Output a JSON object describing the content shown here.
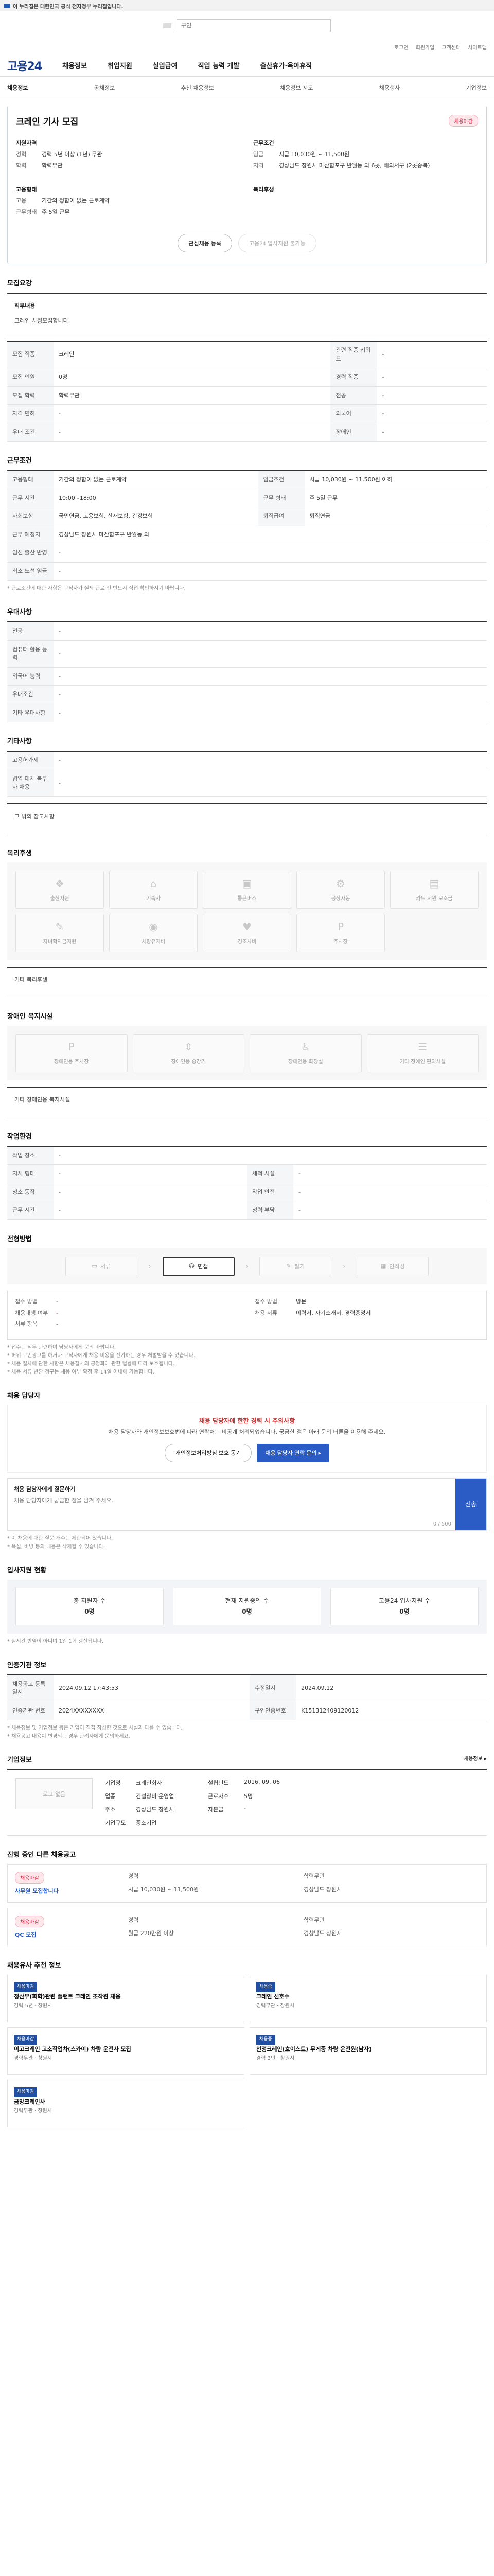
{
  "gov_banner": "이 누리집은 대한민국 공식 전자정부 누리집입니다.",
  "search_placeholder": "구인",
  "util": [
    "로그인",
    "회원가입",
    "고객센터",
    "사이트맵"
  ],
  "logo": "고용24",
  "gnb": [
    "채용정보",
    "취업지원",
    "실업급여",
    "직업 능력 개발",
    "출산휴가·육아휴직"
  ],
  "subnav": [
    "채용정보",
    "공채정보",
    "추천 채용정보",
    "채용정보 지도",
    "채용행사",
    "기업정보"
  ],
  "job": {
    "title": "크레인 기사 모집",
    "badge": "채용마감"
  },
  "summary": {
    "left_head": "지원자격",
    "left_rows": [
      [
        "경력",
        "경력 5년 이상 (1년) 무관"
      ],
      [
        "학력",
        "학력무관"
      ]
    ],
    "right_head": "근무조건",
    "right_rows": [
      [
        "임금",
        "시급 10,030원 ~ 11,500원"
      ],
      [
        "지역",
        "경상남도 창원시 마산합포구 반월동 외 6곳, 해의서구 (2곳중복)"
      ]
    ],
    "l2_head": "고용형태",
    "l2_rows": [
      [
        "고용",
        "기간의 정함이 없는 근로계약"
      ],
      [
        "근무형태",
        "주 5일 근무"
      ]
    ],
    "r2_head": "복리후생"
  },
  "buttons": {
    "save": "관심채용 등록",
    "apply": "고용24 입사지원 불가능"
  },
  "recruit": {
    "heading": "모집요강",
    "job_label": "직무내용",
    "job_text": "크레인 사정모집합니다."
  },
  "recruit_table": [
    [
      "모집 직종",
      "크레인",
      "관련 직종 키워드",
      "-"
    ],
    [
      "모집 인원",
      "0명",
      "경력 직종",
      "-"
    ],
    [
      "모집 학력",
      "학력무관",
      "전공",
      "-"
    ],
    [
      "자격 면허",
      "-",
      "외국어",
      "-"
    ],
    [
      "우대 조건",
      "-",
      "장애인",
      "-"
    ]
  ],
  "work_heading": "근무조건",
  "work_table": [
    [
      "고용형태",
      "기간의 정함이 없는 근로계약",
      "임금조건",
      "시급 10,030원 ~ 11,500원 이하"
    ],
    [
      "근무 시간",
      "10:00~18:00",
      "근무 형태",
      "주 5일 근무"
    ],
    [
      "사회보험",
      "국민연금, 고용보험, 산재보험, 건강보험",
      "퇴직급여",
      "퇴직연금"
    ],
    [
      "근무 예정지",
      "경상남도 창원시 마산합포구 반월동 외",
      "",
      ""
    ]
  ],
  "work_extra": [
    "임신 출산 반영",
    "최소 노선 임금"
  ],
  "work_note": "* 근로조건에 대한 사항은 구직자가 실제 근로 전 반드시 직접 확인하시기 바랍니다.",
  "prep_heading": "우대사항",
  "prep_rows": [
    "전공",
    "컴퓨터 활용 능력",
    "외국어 능력",
    "우대조건",
    "기타 우대사항"
  ],
  "etc_heading": "기타사항",
  "etc_rows": [
    [
      "고용허가제",
      "-"
    ],
    [
      "병역 대체 복무자 채용",
      "-"
    ]
  ],
  "etc_text": "그 밖의 참고사항",
  "welfare_heading": "복리후생",
  "welfare": [
    "출산지원",
    "기숙사",
    "통근버스",
    "공장자동",
    "카드 지원 보조금",
    "자녀학자금지원",
    "차량유지비",
    "경조사비",
    "주차장"
  ],
  "welfare_other": "기타 복리후생",
  "disabled_heading": "장애인 복지시설",
  "disabled": [
    "장애인용 주차장",
    "장애인용 승강기",
    "장애인용 화장실",
    "기타 장애인 편의시설"
  ],
  "disabled_other": "기타 장애인용 복지시설",
  "work_env_heading": "작업환경",
  "work_env": [
    [
      "작업 장소",
      "-",
      "",
      ""
    ],
    [
      "지시 형태",
      "-",
      "세척 시설",
      "-"
    ],
    [
      "청소 동작",
      "-",
      "작업 안전",
      "-"
    ],
    [
      "근무 시간",
      "-",
      "청력 부담",
      "-"
    ]
  ],
  "process_heading": "전형방법",
  "process": [
    "서류",
    "면접",
    "필기",
    "인적성"
  ],
  "doc_left": [
    "접수 방법",
    "채용대행 여부",
    "서류 항목"
  ],
  "doc_right": [
    "접수 방법",
    "방문",
    "채용 서류",
    "이력서, 자기소개서, 경력증명서"
  ],
  "proc_notes": [
    "* 접수는 직무 관련하여 담당자에게 문의 바랍니다.",
    "* 허위 구인광고를 하거나 구직자에게 채용 비용을 전가하는 경우 처벌받을 수 있습니다.",
    "* 채용 절차에 관한 사항은 채용절차의 공정화에 관한 법률에 따라 보호됩니다.",
    "* 채용 서류 반환 청구는 채용 여부 확정 후 14일 이내에 가능합니다."
  ],
  "contact": {
    "heading": "채용 담당자",
    "title": "채용 담당자에 한한 경력 시 주의사항",
    "body": "채용 담당자와 개인정보보호법에 따라 연락처는 비공개 처리되었습니다. 궁금한 점은 아래 문의 버튼을 이용해 주세요.",
    "b1": "개인정보처리방침 보호 동기",
    "b2": "채용 담당자 연락 문의 ▸"
  },
  "qa": {
    "label": "채용 담당자에게 질문하기",
    "count": "0 / 500",
    "placeholder": "채용 담당자에게 궁금한 점을 남겨 주세요.",
    "send": "전송"
  },
  "qa_notes": [
    "* 이 채용에 대한 질문 개수는 제한되어 있습니다.",
    "* 욕설, 비방 등의 내용은 삭제될 수 있습니다."
  ],
  "status_heading": "입사지원 현황",
  "status": [
    [
      "총 지원자 수",
      "0명"
    ],
    [
      "현재 지원중인 수",
      "0명"
    ],
    [
      "고용24 입사지원 수",
      "0명"
    ]
  ],
  "status_note": "* 실시간 반영이 아니며 1일 1회 갱신됩니다.",
  "info_heading": "인증기관 정보",
  "info_table": [
    [
      "채용공고 등록일시",
      "2024.09.12 17:43:53",
      "수정일시",
      "2024.09.12"
    ],
    [
      "인증기관 번호",
      "2024XXXXXXXX",
      "구인인증번호",
      "K151312409120012"
    ]
  ],
  "info_notes": [
    "* 채용정보 및 기업정보 등은 기업이 직접 작성한 것으로 사실과 다를 수 있습니다.",
    "* 채용공고 내용이 변경되는 경우 관리자에게 문의하세요."
  ],
  "company_heading": "기업정보",
  "company_more": "채용정보 ▸",
  "company": {
    "logo": "로고 없음",
    "rows": [
      [
        "기업명",
        "크레인회사",
        "설립년도",
        "2016. 09. 06"
      ],
      [
        "업종",
        "건설장비 운영업",
        "근로자수",
        "5명"
      ],
      [
        "주소",
        "경상남도 창원시",
        "자본금",
        "-"
      ],
      [
        "기업규모",
        "중소기업",
        "",
        ""
      ]
    ]
  },
  "others_heading": "진행 중인 다른 채용공고",
  "others": [
    {
      "tag": "채용마감",
      "title": "사무원 모집합니다",
      "rows": [
        "경력",
        "학력무관",
        "시급 10,030원 ~ 11,500원",
        "경상남도 창원시"
      ]
    },
    {
      "tag": "채용마감",
      "title": "QC 모집",
      "rows": [
        "경력",
        "학력무관",
        "월급 220만원 이상",
        "경상남도 창원시"
      ]
    }
  ],
  "recommend_heading": "채용유사 추천 정보",
  "recommend": [
    {
      "pill": "채용마감",
      "title": "정산부(화학)관련 플랜트 크레인 조작원 채용",
      "meta": "경력 5년 · 창원시"
    },
    {
      "pill": "채용중",
      "title": "크레인 신호수",
      "meta": "경력무관 · 창원시"
    },
    {
      "pill": "채용마감",
      "title": "이고크레인 고소작업차(스카이) 차량 운전사 모집",
      "meta": "경력무관 · 창원시"
    },
    {
      "pill": "채용중",
      "title": "천정크레인(호이스트) 무게중 차량 운전원(남자)",
      "meta": "경력 3년 · 창원시"
    },
    {
      "pill": "채용마감",
      "title": "금망크레인사",
      "meta": "경력무관 · 창원시"
    }
  ]
}
